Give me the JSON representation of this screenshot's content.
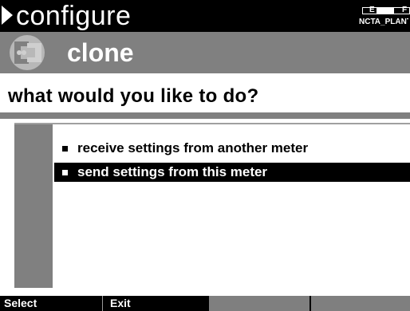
{
  "header": {
    "breadcrumb": "configure",
    "arrow_icon": "play-triangle-icon",
    "battery": {
      "empty_label": "E",
      "full_label": "F",
      "level_fraction": 0.55,
      "site_label": "NCTA_PLANT"
    }
  },
  "titlebar": {
    "icon": "clone-icon",
    "title": "clone"
  },
  "prompt": "what would you like to do?",
  "menu": {
    "items": [
      {
        "label": "receive settings from another meter",
        "selected": false
      },
      {
        "label": "send settings from this meter",
        "selected": true
      }
    ]
  },
  "softkeys": [
    {
      "label": "Select"
    },
    {
      "label": "Exit"
    },
    {
      "label": ""
    },
    {
      "label": ""
    }
  ],
  "colors": {
    "header_bg": "#000000",
    "title_bg": "#808080",
    "selection_bg": "#000000",
    "selection_fg": "#ffffff"
  }
}
